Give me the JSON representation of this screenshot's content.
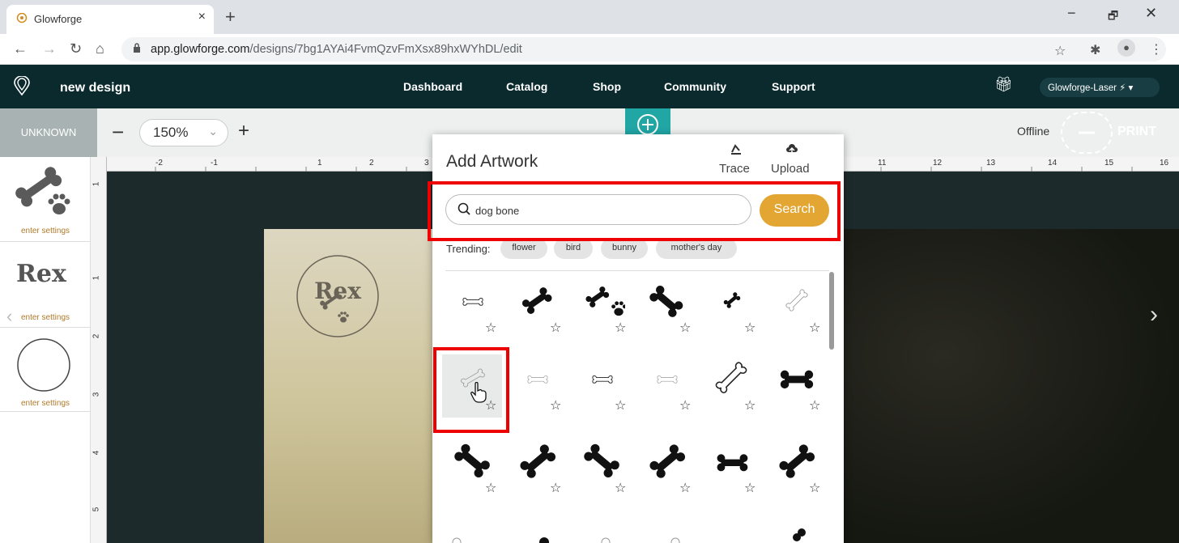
{
  "browser": {
    "tab_title": "Glowforge",
    "tab_close": "×",
    "new_tab": "+",
    "window_controls": [
      "−",
      "🗗",
      "✕"
    ],
    "url_host": "app.glowforge.com",
    "url_path": "/designs/7bg1AYAi4FvmQzvFmXsx89hxWYhDL/edit"
  },
  "app_header": {
    "design_name": "new design",
    "nav": [
      "Dashboard",
      "Catalog",
      "Shop",
      "Community",
      "Support"
    ],
    "machine": "Glowforge-Laser ⚡ ▾"
  },
  "toolbar": {
    "material": "UNKNOWN",
    "zoom_minus": "−",
    "zoom": "150%",
    "zoom_chevron": "⌄",
    "zoom_plus": "+",
    "status": "Offline",
    "print": "PRINT"
  },
  "sidebar": {
    "items": [
      {
        "label": "enter settings",
        "thumb": "bone-paw"
      },
      {
        "label": "enter settings",
        "thumb": "Rex"
      },
      {
        "label": "enter settings",
        "thumb": "circle"
      }
    ],
    "thumb_text": "Rex"
  },
  "canvas": {
    "engraving_text": "Rex"
  },
  "ruler": {
    "h_labels": [
      "-2",
      "-1",
      "1",
      "2",
      "3",
      "11",
      "12",
      "13",
      "14",
      "15",
      "16"
    ],
    "v_labels": [
      "1",
      "2",
      "3",
      "4",
      "5"
    ]
  },
  "add_artwork": {
    "title": "Add Artwork",
    "trace_label": "Trace",
    "upload_label": "Upload",
    "search_value": "dog bone",
    "search_button": "Search",
    "trending_label": "Trending:",
    "trending_chips": [
      "flower",
      "bird",
      "bunny",
      "mother's day"
    ],
    "results_rows": [
      [
        "outline-bone",
        "solid-bone",
        "bone-paw",
        "solid-bone",
        "small-bone",
        "sketch-bone"
      ],
      [
        "sketch-bone-selected",
        "outline-bone",
        "outline-bone-bold",
        "outline-bone",
        "outline-bone-large",
        "solid-bone"
      ],
      [
        "solid-bone",
        "solid-bone",
        "solid-bone",
        "solid-bone",
        "solid-bone",
        "solid-bone"
      ]
    ],
    "star": "☆"
  },
  "colors": {
    "header_bg": "#0a2a2e",
    "search_button": "#e3a633",
    "highlight_red": "#e00000",
    "add_button": "#21a6a6"
  }
}
